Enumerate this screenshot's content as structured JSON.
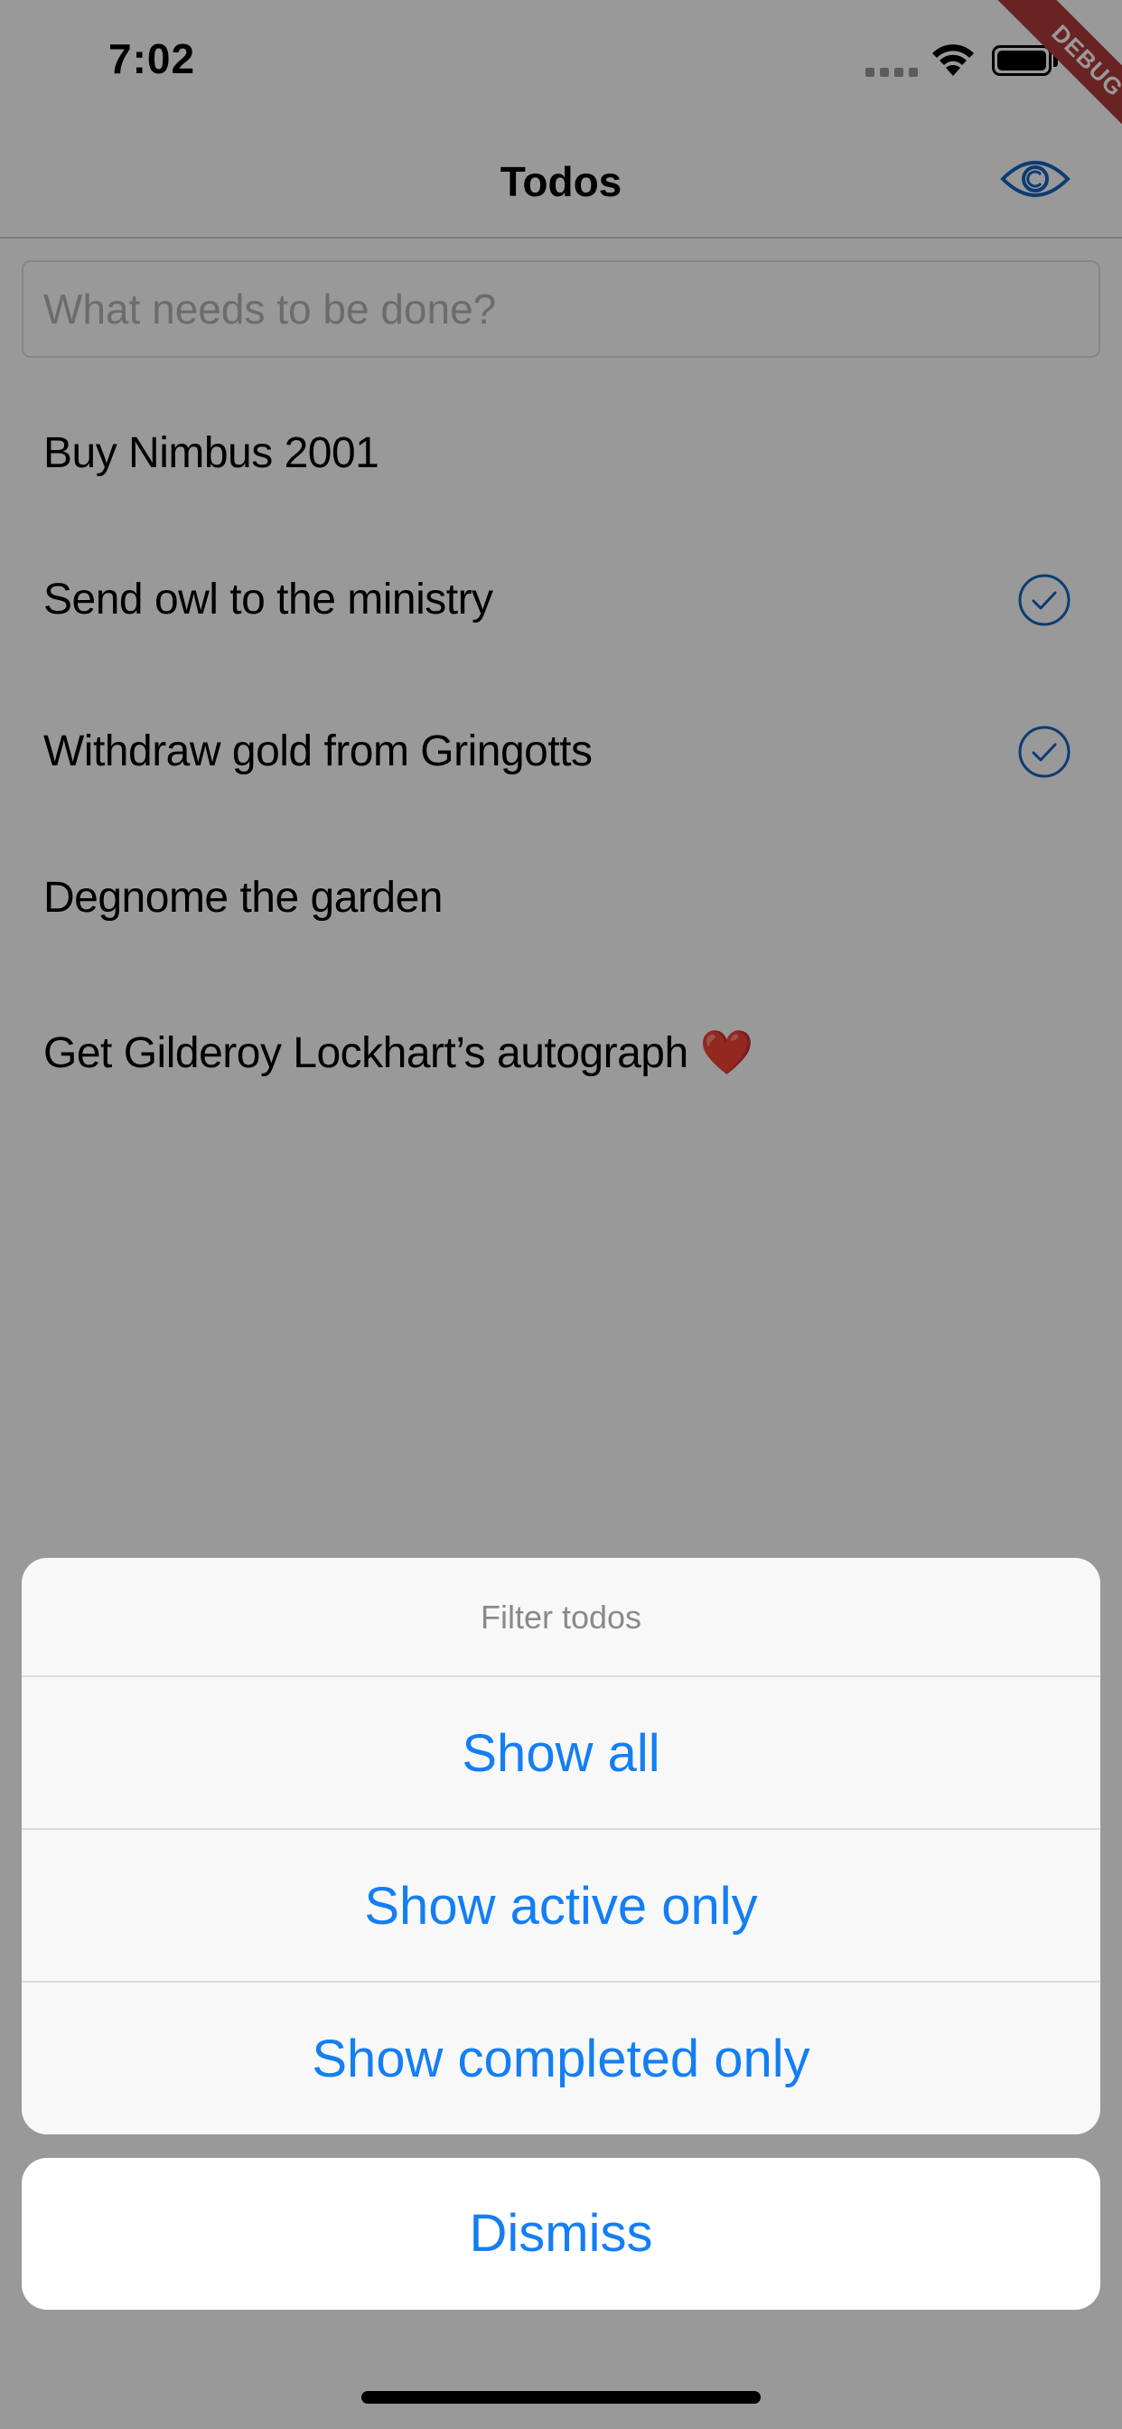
{
  "status_bar": {
    "time": "7:02"
  },
  "nav": {
    "title": "Todos",
    "filter_icon": "eye-icon"
  },
  "input": {
    "placeholder": "What needs to be done?"
  },
  "todos": [
    {
      "text": "Buy Nimbus 2001",
      "completed": false
    },
    {
      "text": "Send owl to the ministry",
      "completed": true
    },
    {
      "text": "Withdraw gold from Gringotts",
      "completed": true
    },
    {
      "text": "Degnome the garden",
      "completed": false
    },
    {
      "text": "Get Gilderoy Lockhart’s autograph",
      "emoji": "❤️",
      "completed": false
    }
  ],
  "action_sheet": {
    "title": "Filter todos",
    "actions": [
      "Show all",
      "Show active only",
      "Show completed only"
    ],
    "cancel": "Dismiss"
  },
  "debug_banner": "DEBUG",
  "colors": {
    "accent": "#147ef3",
    "check_color": "#1565c0",
    "debug_banner": "#b13b3b"
  }
}
